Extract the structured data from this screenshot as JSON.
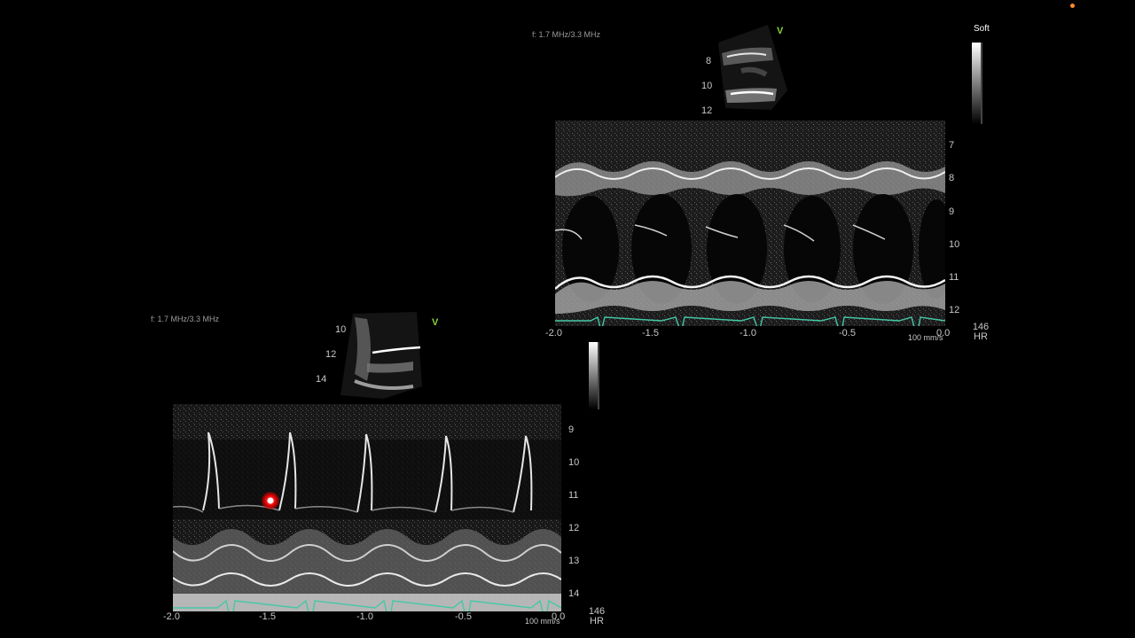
{
  "colors": {
    "background": "#000000",
    "ecg": "#46c8a6",
    "v_marker": "#8cd23c",
    "cursor": "#e00000",
    "status_dot": "#ff8c2a"
  },
  "top_panel": {
    "frequency": "f: 1.7 MHz/3.3 MHz",
    "v_marker": "V",
    "preset": "Soft",
    "thumb_depths": [
      "8",
      "10",
      "12"
    ],
    "depths": [
      "7",
      "8",
      "9",
      "10",
      "11",
      "12"
    ],
    "time_ticks": [
      "-2.0",
      "-1.5",
      "-1.0",
      "-0.5",
      "0.0"
    ],
    "sweep_speed": "100 mm/s",
    "hr_value": "146",
    "hr_label": "HR"
  },
  "bottom_panel": {
    "frequency": "f: 1.7 MHz/3.3 MHz",
    "v_marker": "V",
    "thumb_depths": [
      "10",
      "12",
      "14"
    ],
    "depths": [
      "9",
      "10",
      "11",
      "12",
      "13",
      "14"
    ],
    "time_ticks": [
      "-2.0",
      "-1.5",
      "-1.0",
      "-0.5",
      "0.0"
    ],
    "sweep_speed": "100 mm/s",
    "hr_value": "146",
    "hr_label": "HR"
  }
}
